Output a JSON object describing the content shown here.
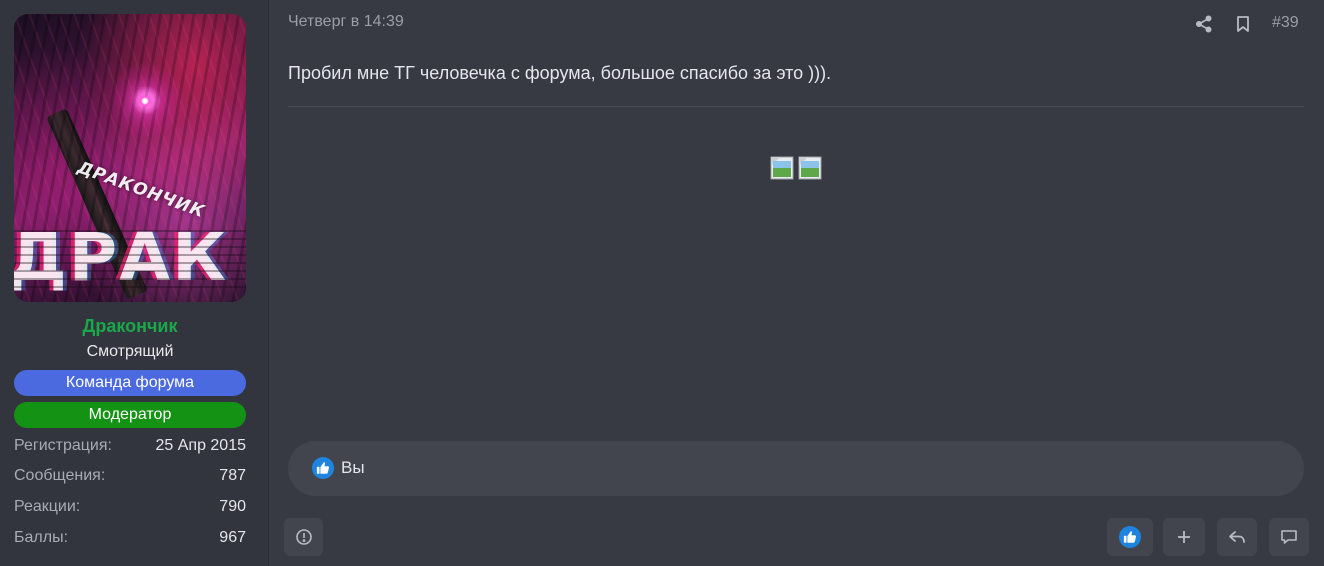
{
  "user": {
    "name": "Дракончик",
    "title": "Смотрящий",
    "avatar_text": "ДРАКОНЧИК",
    "banners": [
      "Команда форума",
      "Модератор"
    ],
    "stats": [
      {
        "label": "Регистрация:",
        "value": "25 Апр 2015"
      },
      {
        "label": "Сообщения:",
        "value": "787"
      },
      {
        "label": "Реакции:",
        "value": "790"
      },
      {
        "label": "Баллы:",
        "value": "967"
      }
    ]
  },
  "post": {
    "date": "Четверг в 14:39",
    "number": "#39",
    "text": "Пробил мне ТГ человечка с форума, большое спасибо за это ))).",
    "reactions_text": "Вы"
  },
  "colors": {
    "background": "#373a43",
    "sidebar": "#32353d",
    "username": "#1aa84a",
    "team_banner": "#4b6ae0",
    "mod_banner": "#149214",
    "like": "#1f84e0"
  },
  "icons": {
    "share": "share-icon",
    "bookmark": "bookmark-icon",
    "report": "report-icon",
    "like": "thumbs-up-icon",
    "add": "plus-icon",
    "reply": "reply-icon",
    "comment": "comment-icon"
  }
}
